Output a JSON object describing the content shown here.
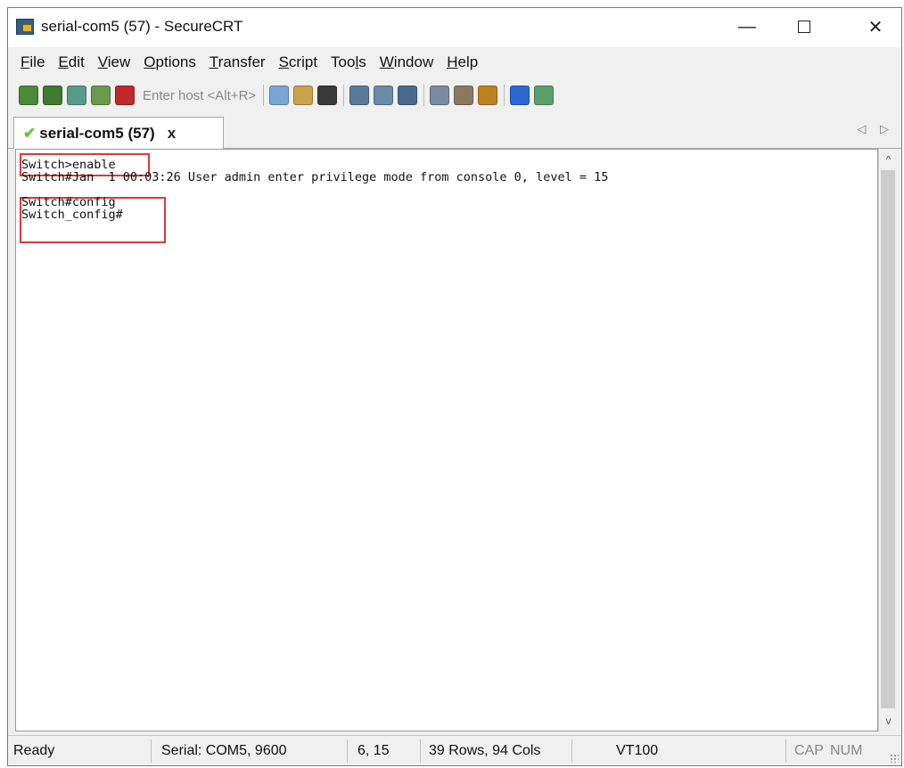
{
  "window": {
    "title": "serial-com5 (57) - SecureCRT",
    "controls": {
      "minimize": "—",
      "close": "✕"
    }
  },
  "menu": [
    {
      "pre": "",
      "u": "F",
      "post": "ile"
    },
    {
      "pre": "",
      "u": "E",
      "post": "dit"
    },
    {
      "pre": "",
      "u": "V",
      "post": "iew"
    },
    {
      "pre": "",
      "u": "O",
      "post": "ptions"
    },
    {
      "pre": "",
      "u": "T",
      "post": "ransfer"
    },
    {
      "pre": "",
      "u": "S",
      "post": "cript"
    },
    {
      "pre": "Too",
      "u": "l",
      "post": "s"
    },
    {
      "pre": "",
      "u": "W",
      "post": "indow"
    },
    {
      "pre": "",
      "u": "H",
      "post": "elp"
    }
  ],
  "toolbar": {
    "host_placeholder": "Enter host <Alt+R>",
    "icons_left": [
      {
        "name": "connect-icon",
        "color": "#4a8a3a"
      },
      {
        "name": "quick-connect-icon",
        "color": "#3f7a2e"
      },
      {
        "name": "connect-tab-icon",
        "color": "#5a9a8a"
      },
      {
        "name": "reconnect-icon",
        "color": "#6a9a4a"
      },
      {
        "name": "disconnect-icon",
        "color": "#c0282a"
      }
    ],
    "icons_right": [
      {
        "name": "copy-icon",
        "color": "#7aa6d6",
        "sep_before": false
      },
      {
        "name": "paste-icon",
        "color": "#c9a24a",
        "sep_before": false
      },
      {
        "name": "find-icon",
        "color": "#3a3a3a",
        "sep_before": false
      },
      {
        "name": "print-setup-icon",
        "color": "#5a7a9a",
        "sep_before": true
      },
      {
        "name": "print-selection-icon",
        "color": "#6a8aaa",
        "sep_before": false
      },
      {
        "name": "print-icon",
        "color": "#4a6a8a",
        "sep_before": false
      },
      {
        "name": "session-options-icon",
        "color": "#7a8aa0",
        "sep_before": true
      },
      {
        "name": "global-options-icon",
        "color": "#8a7a60",
        "sep_before": false
      },
      {
        "name": "keymap-icon",
        "color": "#c08020",
        "sep_before": false
      },
      {
        "name": "help-icon",
        "color": "#2a6ad0",
        "sep_before": true
      },
      {
        "name": "sftp-icon",
        "color": "#5aa06a",
        "sep_before": false
      }
    ]
  },
  "tab": {
    "check": "✔",
    "label": "serial-com5 (57)",
    "close": "x",
    "scroll": "◁ ▷"
  },
  "terminal": {
    "lines": [
      "Switch>enable",
      "Switch#Jan  1 00:03:26 User admin enter privilege mode from console 0, level = 15",
      "",
      "Switch#config",
      "Switch_config#"
    ]
  },
  "scrollbar": {
    "up": "^",
    "down": "v"
  },
  "status": {
    "state": "Ready",
    "serial": "Serial: COM5, 9600",
    "cursor": "6,  15",
    "size": "39 Rows, 94 Cols",
    "emulation": "VT100",
    "cap": "CAP",
    "num": "NUM"
  }
}
